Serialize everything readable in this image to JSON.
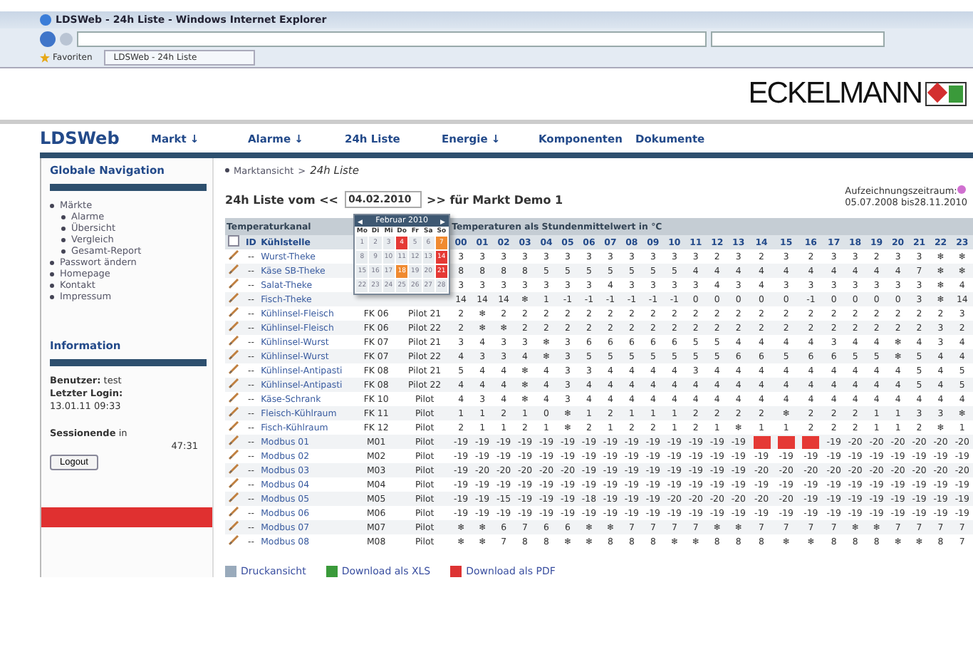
{
  "window": {
    "title": "LDSWeb - 24h Liste - Windows Internet Explorer"
  },
  "browser": {
    "favorites": "Favoriten",
    "tab": "LDSWeb - 24h Liste"
  },
  "brand": {
    "logo": "ECKELMANN",
    "app": "LDSWeb"
  },
  "nav": [
    "Markt ↓",
    "Alarme ↓",
    "24h Liste",
    "Energie ↓",
    "Komponenten",
    "Dokumente"
  ],
  "sidebar": {
    "heading": "Globale Navigation",
    "groups": [
      {
        "label": "Märkte",
        "children": [
          {
            "label": "Alarme"
          },
          {
            "label": "Übersicht"
          },
          {
            "label": "Vergleich"
          },
          {
            "label": "Gesamt-Report"
          }
        ]
      },
      {
        "label": "Passwort ändern"
      },
      {
        "label": "Homepage"
      },
      {
        "label": "Kontakt"
      },
      {
        "label": "Impressum"
      }
    ],
    "info_heading": "Information",
    "user_label": "Benutzer:",
    "user": "test",
    "login_label": "Letzter Login:",
    "login": "13.01.11 09:33",
    "session_label": "Sessionende",
    "session_in": "in",
    "session": "47:31",
    "logout": "Logout"
  },
  "breadcrumb": {
    "parent": "Marktansicht",
    "sep": ">",
    "current": "24h Liste"
  },
  "heading": {
    "before": "24h Liste vom <<",
    "date": "04.02.2010",
    "after": ">> für Markt Demo 1"
  },
  "period": {
    "label": "Aufzeichnungszeitraum:",
    "range": "05.07.2008 bis28.11.2010",
    "color": "#d070d0"
  },
  "calendar": {
    "prev": "◀",
    "next": "▶",
    "title": "Februar 2010",
    "weekdays": [
      "Mo",
      "Di",
      "Mi",
      "Do",
      "Fr",
      "Sa",
      "So"
    ],
    "days": [
      {
        "d": "1"
      },
      {
        "d": "2"
      },
      {
        "d": "3"
      },
      {
        "d": "4",
        "color": "#e53935"
      },
      {
        "d": "5"
      },
      {
        "d": "6"
      },
      {
        "d": "7",
        "color": "#f08a30"
      },
      {
        "d": "8"
      },
      {
        "d": "9"
      },
      {
        "d": "10"
      },
      {
        "d": "11"
      },
      {
        "d": "12"
      },
      {
        "d": "13"
      },
      {
        "d": "14",
        "color": "#e53935"
      },
      {
        "d": "15"
      },
      {
        "d": "16"
      },
      {
        "d": "17"
      },
      {
        "d": "18",
        "color": "#f08a30"
      },
      {
        "d": "19"
      },
      {
        "d": "20"
      },
      {
        "d": "21",
        "color": "#e53935"
      },
      {
        "d": "22"
      },
      {
        "d": "23"
      },
      {
        "d": "24"
      },
      {
        "d": "25"
      },
      {
        "d": "26"
      },
      {
        "d": "27"
      },
      {
        "d": "28"
      }
    ]
  },
  "table": {
    "group_left": "Temperaturkanal",
    "group_right": "Temperaturen als Stundenmittelwert in °C",
    "col_id": "ID",
    "col_name": "Kühlstelle",
    "select_all_checked": false,
    "hours": [
      "00",
      "01",
      "02",
      "03",
      "04",
      "05",
      "06",
      "07",
      "08",
      "09",
      "10",
      "11",
      "12",
      "13",
      "14",
      "15",
      "16",
      "17",
      "18",
      "19",
      "20",
      "21",
      "22",
      "23"
    ],
    "rows": [
      {
        "id": "--",
        "name": "Wurst-Theke",
        "values": [
          "3",
          "3",
          "3",
          "3",
          "3",
          "3",
          "3",
          "3",
          "3",
          "3",
          "3",
          "3",
          "2",
          "3",
          "2",
          "3",
          "2",
          "3",
          "3",
          "2",
          "3",
          "3",
          "❄",
          "❄"
        ]
      },
      {
        "id": "--",
        "name": "Käse SB-Theke",
        "values": [
          "8",
          "8",
          "8",
          "8",
          "5",
          "5",
          "5",
          "5",
          "5",
          "5",
          "5",
          "4",
          "4",
          "4",
          "4",
          "4",
          "4",
          "4",
          "4",
          "4",
          "4",
          "7",
          "❄",
          "❄"
        ]
      },
      {
        "id": "--",
        "name": "Salat-Theke",
        "values": [
          "3",
          "3",
          "3",
          "3",
          "3",
          "3",
          "3",
          "4",
          "3",
          "3",
          "3",
          "3",
          "4",
          "3",
          "4",
          "3",
          "3",
          "3",
          "3",
          "3",
          "3",
          "3",
          "❄",
          "4"
        ]
      },
      {
        "id": "--",
        "name": "Fisch-Theke",
        "values": [
          "14",
          "14",
          "14",
          "❄",
          "1",
          "-1",
          "-1",
          "-1",
          "-1",
          "-1",
          "-1",
          "0",
          "0",
          "0",
          "0",
          "0",
          "-1",
          "0",
          "0",
          "0",
          "0",
          "3",
          "❄",
          "14"
        ]
      },
      {
        "id": "--",
        "name": "Kühlinsel-Fleisch",
        "fk": "FK 06",
        "typ": "Pilot 21",
        "values": [
          "2",
          "❄",
          "2",
          "2",
          "2",
          "2",
          "2",
          "2",
          "2",
          "2",
          "2",
          "2",
          "2",
          "2",
          "2",
          "2",
          "2",
          "2",
          "2",
          "2",
          "2",
          "2",
          "2",
          "3"
        ]
      },
      {
        "id": "--",
        "name": "Kühlinsel-Fleisch",
        "fk": "FK 06",
        "typ": "Pilot 22",
        "values": [
          "2",
          "❄",
          "❄",
          "2",
          "2",
          "2",
          "2",
          "2",
          "2",
          "2",
          "2",
          "2",
          "2",
          "2",
          "2",
          "2",
          "2",
          "2",
          "2",
          "2",
          "2",
          "2",
          "3",
          "2"
        ]
      },
      {
        "id": "--",
        "name": "Kühlinsel-Wurst",
        "fk": "FK 07",
        "typ": "Pilot 21",
        "values": [
          "3",
          "4",
          "3",
          "3",
          "❄",
          "3",
          "6",
          "6",
          "6",
          "6",
          "6",
          "5",
          "5",
          "4",
          "4",
          "4",
          "4",
          "3",
          "4",
          "4",
          "❄",
          "4",
          "3",
          "4"
        ]
      },
      {
        "id": "--",
        "name": "Kühlinsel-Wurst",
        "fk": "FK 07",
        "typ": "Pilot 22",
        "values": [
          "4",
          "3",
          "3",
          "4",
          "❄",
          "3",
          "5",
          "5",
          "5",
          "5",
          "5",
          "5",
          "5",
          "6",
          "6",
          "5",
          "6",
          "6",
          "5",
          "5",
          "❄",
          "5",
          "4",
          "4"
        ]
      },
      {
        "id": "--",
        "name": "Kühlinsel-Antipasti",
        "fk": "FK 08",
        "typ": "Pilot 21",
        "values": [
          "5",
          "4",
          "4",
          "❄",
          "4",
          "3",
          "3",
          "4",
          "4",
          "4",
          "4",
          "3",
          "4",
          "4",
          "4",
          "4",
          "4",
          "4",
          "4",
          "4",
          "4",
          "5",
          "4",
          "5"
        ]
      },
      {
        "id": "--",
        "name": "Kühlinsel-Antipasti",
        "fk": "FK 08",
        "typ": "Pilot 22",
        "values": [
          "4",
          "4",
          "4",
          "❄",
          "4",
          "3",
          "4",
          "4",
          "4",
          "4",
          "4",
          "4",
          "4",
          "4",
          "4",
          "4",
          "4",
          "4",
          "4",
          "4",
          "4",
          "5",
          "4",
          "5"
        ]
      },
      {
        "id": "--",
        "name": "Käse-Schrank",
        "fk": "FK 10",
        "typ": "Pilot",
        "values": [
          "4",
          "3",
          "4",
          "❄",
          "4",
          "3",
          "4",
          "4",
          "4",
          "4",
          "4",
          "4",
          "4",
          "4",
          "4",
          "4",
          "4",
          "4",
          "4",
          "4",
          "4",
          "4",
          "4",
          "4"
        ]
      },
      {
        "id": "--",
        "name": "Fleisch-Kühlraum",
        "fk": "FK 11",
        "typ": "Pilot",
        "values": [
          "1",
          "1",
          "2",
          "1",
          "0",
          "❄",
          "1",
          "2",
          "1",
          "1",
          "1",
          "2",
          "2",
          "2",
          "2",
          "❄",
          "2",
          "2",
          "2",
          "1",
          "1",
          "3",
          "3",
          "❄"
        ]
      },
      {
        "id": "--",
        "name": "Fisch-Kühlraum",
        "fk": "FK 12",
        "typ": "Pilot",
        "values": [
          "2",
          "1",
          "1",
          "2",
          "1",
          "❄",
          "2",
          "1",
          "2",
          "2",
          "1",
          "2",
          "1",
          "❄",
          "1",
          "1",
          "2",
          "2",
          "2",
          "1",
          "1",
          "2",
          "❄",
          "1"
        ]
      },
      {
        "id": "--",
        "name": "Modbus 01",
        "fk": "M01",
        "typ": "Pilot",
        "values": [
          "-19",
          "-19",
          "-19",
          "-19",
          "-19",
          "-19",
          "-19",
          "-19",
          "-19",
          "-19",
          "-19",
          "-19",
          "-19",
          "-19",
          {
            "kind": "alarm"
          },
          {
            "kind": "alarm"
          },
          {
            "kind": "alarm"
          },
          "-19",
          "-20",
          "-20",
          "-20",
          "-20",
          "-20",
          "-20"
        ]
      },
      {
        "id": "--",
        "name": "Modbus 02",
        "fk": "M02",
        "typ": "Pilot",
        "values": [
          "-19",
          "-19",
          "-19",
          "-19",
          "-19",
          "-19",
          "-19",
          "-19",
          "-19",
          "-19",
          "-19",
          "-19",
          "-19",
          "-19",
          "-19",
          "-19",
          "-19",
          "-19",
          "-19",
          "-19",
          "-19",
          "-19",
          "-19",
          "-19"
        ]
      },
      {
        "id": "--",
        "name": "Modbus 03",
        "fk": "M03",
        "typ": "Pilot",
        "values": [
          "-19",
          "-20",
          "-20",
          "-20",
          "-20",
          "-20",
          "-19",
          "-19",
          "-19",
          "-19",
          "-19",
          "-19",
          "-19",
          "-19",
          "-20",
          "-20",
          "-20",
          "-20",
          "-20",
          "-20",
          "-20",
          "-20",
          "-20",
          "-20"
        ]
      },
      {
        "id": "--",
        "name": "Modbus 04",
        "fk": "M04",
        "typ": "Pilot",
        "values": [
          "-19",
          "-19",
          "-19",
          "-19",
          "-19",
          "-19",
          "-19",
          "-19",
          "-19",
          "-19",
          "-19",
          "-19",
          "-19",
          "-19",
          "-19",
          "-19",
          "-19",
          "-19",
          "-19",
          "-19",
          "-19",
          "-19",
          "-19",
          "-19"
        ]
      },
      {
        "id": "--",
        "name": "Modbus 05",
        "fk": "M05",
        "typ": "Pilot",
        "values": [
          "-19",
          "-19",
          "-15",
          "-19",
          "-19",
          "-19",
          "-18",
          "-19",
          "-19",
          "-19",
          "-20",
          "-20",
          "-20",
          "-20",
          "-20",
          "-20",
          "-19",
          "-19",
          "-19",
          "-19",
          "-19",
          "-19",
          "-19",
          "-19"
        ]
      },
      {
        "id": "--",
        "name": "Modbus 06",
        "fk": "M06",
        "typ": "Pilot",
        "values": [
          "-19",
          "-19",
          "-19",
          "-19",
          "-19",
          "-19",
          "-19",
          "-19",
          "-19",
          "-19",
          "-19",
          "-19",
          "-19",
          "-19",
          "-19",
          "-19",
          "-19",
          "-19",
          "-19",
          "-19",
          "-19",
          "-19",
          "-19",
          "-19"
        ]
      },
      {
        "id": "--",
        "name": "Modbus 07",
        "fk": "M07",
        "typ": "Pilot",
        "values": [
          "❄",
          "❄",
          "6",
          "7",
          "6",
          "6",
          "❄",
          "❄",
          "7",
          "7",
          "7",
          "7",
          "❄",
          "❄",
          "7",
          "7",
          "7",
          "7",
          "❄",
          "❄",
          "7",
          "7",
          "7",
          "7"
        ]
      },
      {
        "id": "--",
        "name": "Modbus 08",
        "fk": "M08",
        "typ": "Pilot",
        "values": [
          "❄",
          "❄",
          "7",
          "8",
          "8",
          "❄",
          "❄",
          "8",
          "8",
          "8",
          "❄",
          "❄",
          "8",
          "8",
          "8",
          "❄",
          "❄",
          "8",
          "8",
          "8",
          "❄",
          "❄",
          "8",
          "7"
        ]
      }
    ]
  },
  "footer_links": [
    "Druckansicht",
    "Download als XLS",
    "Download als PDF"
  ]
}
